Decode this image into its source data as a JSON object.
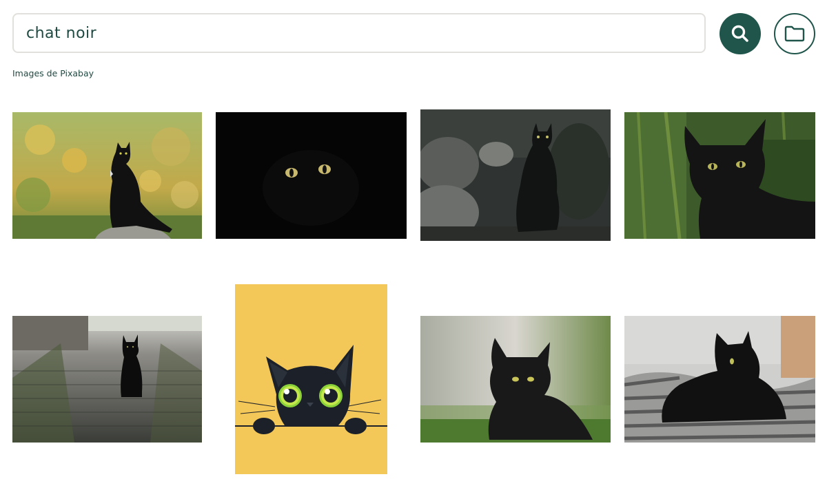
{
  "search": {
    "query": "chat noir",
    "button_icon": "search-icon",
    "folder_icon": "folder-icon"
  },
  "source": {
    "label": "Images de Pixabay"
  },
  "results": [
    {
      "subject": "black cat sitting on rock, yellow flower bush background"
    },
    {
      "subject": "black cat in darkness, only glowing eyes visible"
    },
    {
      "subject": "black cat sitting among dark rocks"
    },
    {
      "subject": "black cat close-up portrait, green grass background"
    },
    {
      "subject": "black kitten on mossy cobblestone path"
    },
    {
      "subject": "cartoon black cat peeking over edge, yellow background"
    },
    {
      "subject": "black cat lying in grass, blurred background"
    },
    {
      "subject": "black cat lying on striped blanket"
    }
  ],
  "colors": {
    "accent": "#1f554a",
    "text": "#1f4a42",
    "border": "#e2e0dc"
  }
}
